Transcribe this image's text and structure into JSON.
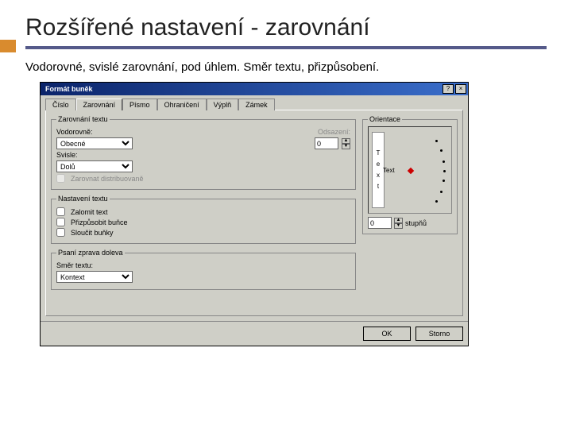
{
  "slide": {
    "title": "Rozšířené nastavení - zarovnání",
    "body": "Vodorovné, svislé zarovnání, pod úhlem. Směr textu, přizpůsobení."
  },
  "dialog": {
    "title": "Formát buněk",
    "tabs": {
      "t0": "Číslo",
      "t1": "Zarovnání",
      "t2": "Písmo",
      "t3": "Ohraničení",
      "t4": "Výplň",
      "t5": "Zámek"
    },
    "alignLegend": "Zarovnání textu",
    "horizLabel": "Vodorovně:",
    "horizValue": "Obecné",
    "indentLabel": "Odsazení:",
    "indentValue": "0",
    "vertLabel": "Svisle:",
    "vertValue": "Dolů",
    "distCheck": "Zarovnat distribuovaně",
    "settingsLegend": "Nastavení textu",
    "wrap": "Zalomit text",
    "shrink": "Přizpůsobit buňce",
    "merge": "Sloučit buňky",
    "rtlLegend": "Psaní zprava doleva",
    "dirLabel": "Směr textu:",
    "dirValue": "Kontext",
    "orientLegend": "Orientace",
    "orientWord": [
      "T",
      "e",
      "x",
      "t"
    ],
    "orientLbl": "Text",
    "degVal": "0",
    "degUnit": "stupňů",
    "ok": "OK",
    "cancel": "Storno"
  }
}
